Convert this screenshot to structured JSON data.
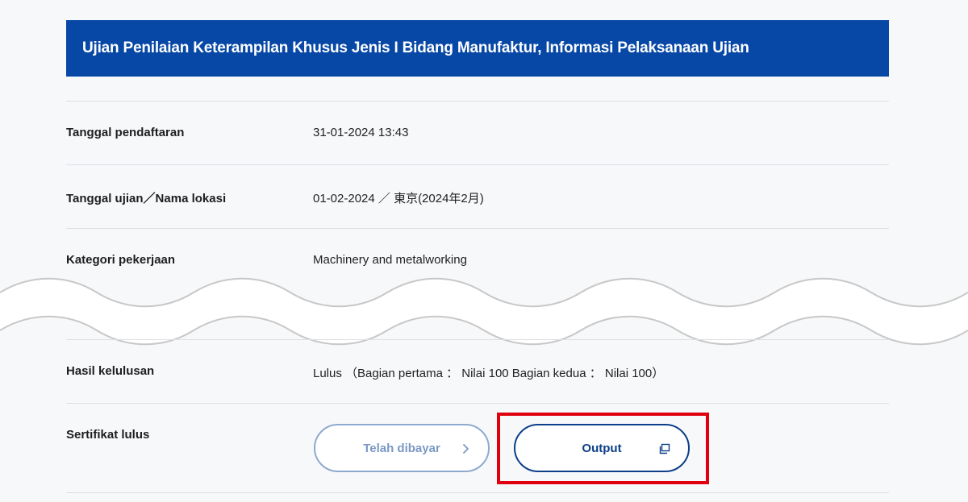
{
  "header": {
    "title": "Ujian Penilaian Keterampilan Khusus Jenis I Bidang Manufaktur, Informasi Pelaksanaan Ujian"
  },
  "rows": [
    {
      "label": "Tanggal pendaftaran",
      "value": "31-01-2024 13:43"
    },
    {
      "label": "Tanggal ujian／Nama lokasi",
      "value": "01-02-2024 ／ 東京(2024年2月)"
    },
    {
      "label": "Kategori pekerjaan",
      "value": "Machinery and metalworking"
    },
    {
      "label": "Hasil kelulusan",
      "value": "Lulus （Bagian pertama ： Nilai 100 Bagian kedua ： Nilai 100）"
    },
    {
      "label": "Sertifikat lulus",
      "value": ""
    }
  ],
  "buttons": {
    "paid_label": "Telah dibayar",
    "output_label": "Output"
  },
  "icons": {
    "paid_icon": "chevron-right-icon",
    "output_icon": "external-window-icon"
  },
  "colors": {
    "header_bg": "#0747a6",
    "primary": "#0c3e8a",
    "disabled": "#8ea9cf",
    "highlight": "#e0000f"
  }
}
